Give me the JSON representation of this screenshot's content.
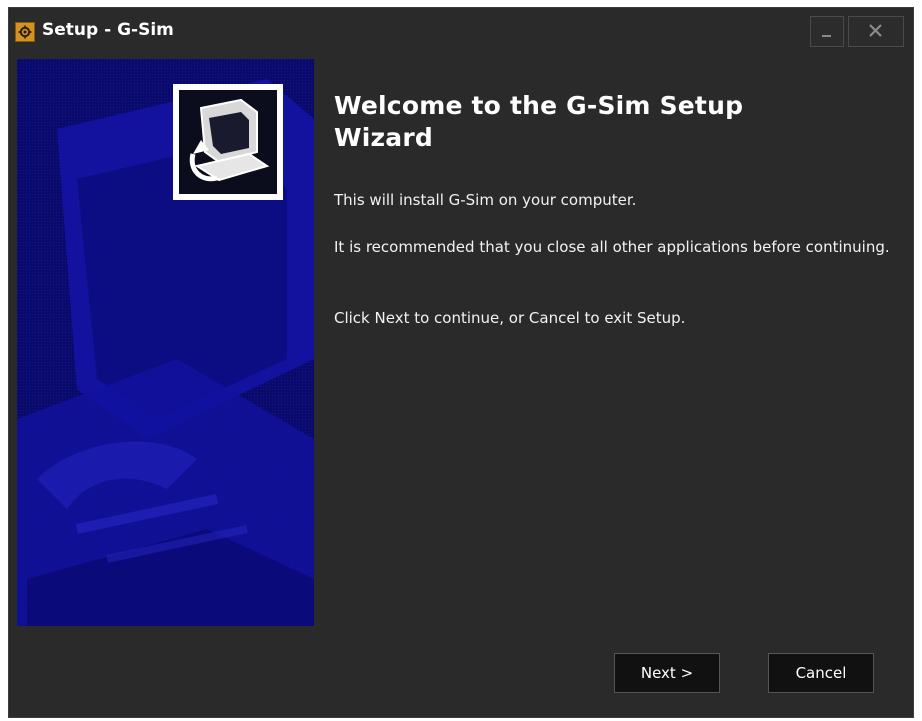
{
  "window": {
    "title": "Setup - G-Sim",
    "controls": {
      "minimize": "minimize-icon",
      "close": "close-icon"
    }
  },
  "wizard": {
    "heading": "Welcome to the G-Sim Setup Wizard",
    "paragraphs": [
      "This will install G-Sim on your computer.",
      "It is recommended that you close all other applications before continuing.",
      "Click Next to continue, or Cancel to exit Setup."
    ]
  },
  "buttons": {
    "next": "Next >",
    "cancel": "Cancel"
  },
  "colors": {
    "background": "#2a2a2a",
    "side_panel": "#0a0a70",
    "app_icon": "#d4921f"
  }
}
